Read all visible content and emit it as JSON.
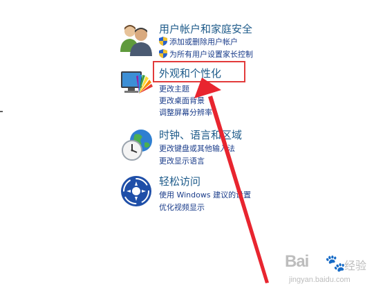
{
  "categories": [
    {
      "title": "用户帐户和家庭安全",
      "icon": "users-icon",
      "links": [
        {
          "label": "添加或删除用户帐户",
          "shield": true
        },
        {
          "label": "为所有用户设置家长控制",
          "shield": true
        }
      ]
    },
    {
      "title": "外观和个性化",
      "icon": "appearance-icon",
      "links": [
        {
          "label": "更改主题",
          "shield": false
        },
        {
          "label": "更改桌面背景",
          "shield": false
        },
        {
          "label": "调整屏幕分辨率",
          "shield": false
        }
      ]
    },
    {
      "title": "时钟、语言和区域",
      "icon": "clock-globe-icon",
      "links": [
        {
          "label": "更改键盘或其他输入法",
          "shield": false
        },
        {
          "label": "更改显示语言",
          "shield": false
        }
      ]
    },
    {
      "title": "轻松访问",
      "icon": "ease-of-access-icon",
      "links": [
        {
          "label": "使用 Windows 建议的设置",
          "shield": false
        },
        {
          "label": "优化视频显示",
          "shield": false
        }
      ]
    }
  ],
  "annotation": {
    "highlight_color": "#e23a3a",
    "arrow_color": "#e8252f"
  },
  "watermark": {
    "logo": "Bai",
    "sub": "经验",
    "url": "jingyan.baidu.com"
  }
}
